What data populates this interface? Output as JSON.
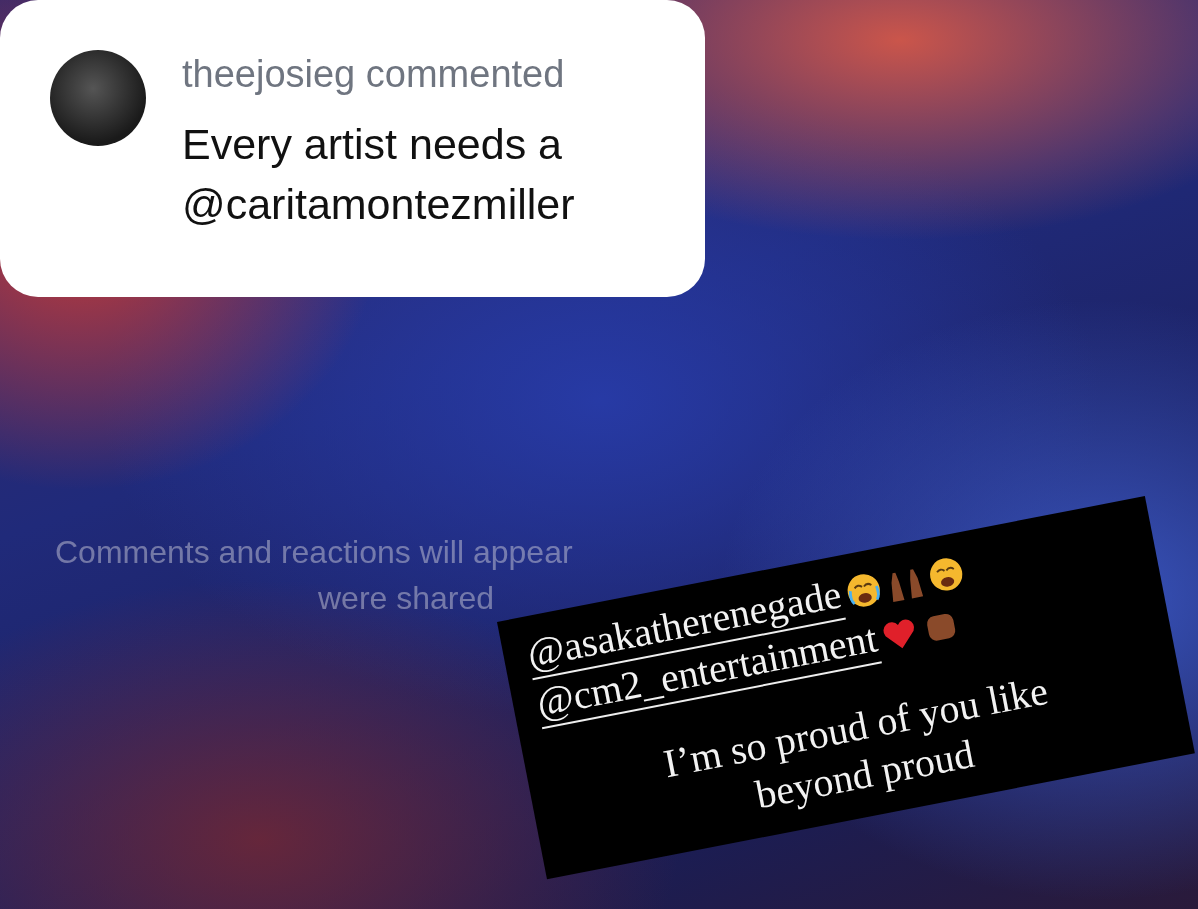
{
  "comment_card": {
    "header": "theejosieg commented",
    "lines": [
      "Every artist needs a",
      "@caritamontezmiller"
    ]
  },
  "empty_state": {
    "lines": [
      "Comments and reactions will appear",
      "were shared"
    ]
  },
  "sticker": {
    "lines": [
      {
        "kind": "mention",
        "text": "@asakatherenegade"
      },
      {
        "kind": "mention",
        "text": "@cm2_entertainment"
      },
      {
        "kind": "plain",
        "text": "I’m so proud of you like"
      },
      {
        "kind": "plain",
        "text": "beyond proud"
      }
    ]
  }
}
